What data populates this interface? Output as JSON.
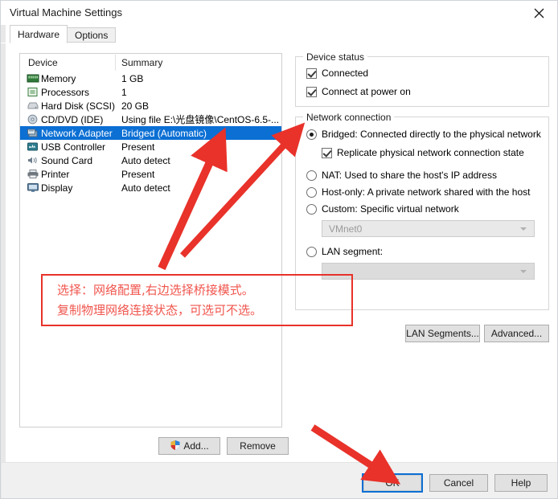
{
  "window": {
    "title": "Virtual Machine Settings",
    "close_icon": "close-icon"
  },
  "tabs": [
    {
      "label": "Hardware",
      "active": true
    },
    {
      "label": "Options",
      "active": false
    }
  ],
  "device_list": {
    "columns": [
      "Device",
      "Summary"
    ],
    "rows": [
      {
        "icon": "memory-icon",
        "name": "Memory",
        "summary": "1 GB",
        "selected": false
      },
      {
        "icon": "processor-icon",
        "name": "Processors",
        "summary": "1",
        "selected": false
      },
      {
        "icon": "hard-disk-icon",
        "name": "Hard Disk (SCSI)",
        "summary": "20 GB",
        "selected": false
      },
      {
        "icon": "cd-dvd-icon",
        "name": "CD/DVD (IDE)",
        "summary": "Using file E:\\光盘镜像\\CentOS-6.5-...",
        "selected": false
      },
      {
        "icon": "network-adapter-icon",
        "name": "Network Adapter",
        "summary": "Bridged (Automatic)",
        "selected": true
      },
      {
        "icon": "usb-controller-icon",
        "name": "USB Controller",
        "summary": "Present",
        "selected": false
      },
      {
        "icon": "sound-card-icon",
        "name": "Sound Card",
        "summary": "Auto detect",
        "selected": false
      },
      {
        "icon": "printer-icon",
        "name": "Printer",
        "summary": "Present",
        "selected": false
      },
      {
        "icon": "display-icon",
        "name": "Display",
        "summary": "Auto detect",
        "selected": false
      }
    ],
    "add_button": "Add...",
    "remove_button": "Remove"
  },
  "device_status": {
    "group_label": "Device status",
    "connected": {
      "label": "Connected",
      "checked": true
    },
    "connect_at_power_on": {
      "label": "Connect at power on",
      "checked": true
    }
  },
  "network_connection": {
    "group_label": "Network connection",
    "options": [
      {
        "label": "Bridged: Connected directly to the physical network",
        "selected": true
      },
      {
        "label": "NAT: Used to share the host's IP address",
        "selected": false
      },
      {
        "label": "Host-only: A private network shared with the host",
        "selected": false
      },
      {
        "label": "Custom: Specific virtual network",
        "selected": false
      },
      {
        "label": "LAN segment:",
        "selected": false
      }
    ],
    "replicate": {
      "label": "Replicate physical network connection state",
      "checked": true
    },
    "custom_network_value": "VMnet0",
    "lan_segment_value": "",
    "lan_segments_button": "LAN Segments...",
    "advanced_button": "Advanced..."
  },
  "footer": {
    "ok": "OK",
    "cancel": "Cancel",
    "help": "Help"
  },
  "annotation": {
    "line1": "选择：网络配置,右边选择桥接模式。",
    "line2": "复制物理网络连接状态，可选可不选。",
    "box_color": "#e8322a",
    "text_color": "#f0564e"
  },
  "colors": {
    "selection_blue": "#0b6fd4",
    "annotation_red": "#e8322a",
    "window_bg": "#ffffff",
    "footer_bg": "#f0f0f0"
  }
}
